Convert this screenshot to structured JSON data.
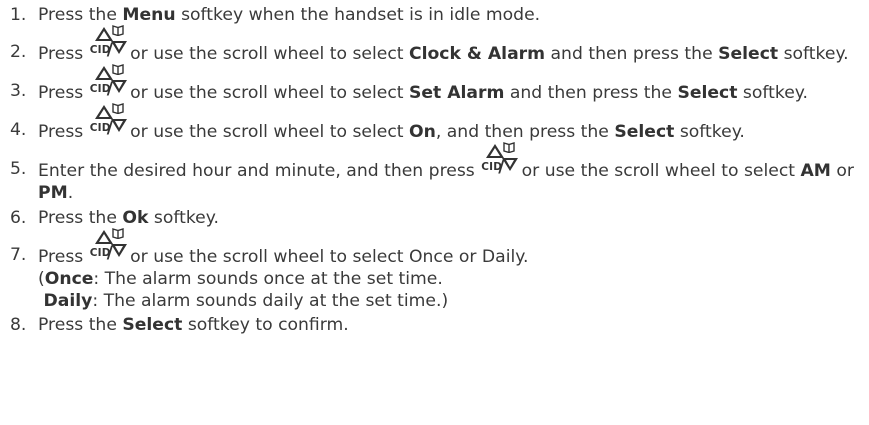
{
  "steps": [
    {
      "num": "1.",
      "parts": [
        "Press the ",
        "Menu",
        " softkey when the handset is in idle mode."
      ]
    },
    {
      "num": "2.",
      "parts": [
        "Press ",
        " or use the scroll wheel to select ",
        "Clock & Alarm",
        " and then press the ",
        "Select",
        " softkey."
      ]
    },
    {
      "num": "3.",
      "parts": [
        "Press ",
        " or use the scroll wheel to select ",
        "Set Alarm",
        " and then press the ",
        "Select",
        " softkey."
      ]
    },
    {
      "num": "4.",
      "parts": [
        "Press ",
        " or use the scroll wheel to select ",
        "On",
        ", and then press the ",
        "Select",
        " softkey."
      ]
    },
    {
      "num": "5.",
      "parts": [
        "Enter the desired hour and minute, and then press ",
        " or use the scroll wheel to select ",
        "AM",
        " or ",
        "PM",
        "."
      ]
    },
    {
      "num": "6.",
      "parts": [
        "Press the ",
        "Ok",
        " softkey."
      ]
    },
    {
      "num": "7.",
      "parts": [
        "Press ",
        " or use the scroll wheel to select Once or Daily."
      ],
      "extra": [
        [
          "(",
          "Once",
          ": The alarm sounds once at the set time."
        ],
        [
          " ",
          "Daily",
          ": The alarm sounds daily at the set time.)"
        ]
      ]
    },
    {
      "num": "8.",
      "parts": [
        "Press the ",
        "Select",
        " softkey to confirm."
      ]
    }
  ],
  "key_icon": {
    "label": "CID",
    "icon_names": [
      "up-triangle-icon",
      "book-icon",
      "down-triangle-icon"
    ]
  }
}
